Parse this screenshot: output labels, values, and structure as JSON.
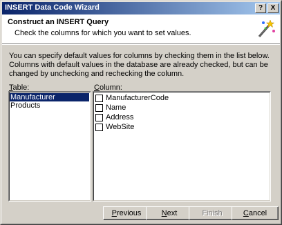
{
  "window": {
    "title": "INSERT Data Code Wizard",
    "help_glyph": "?",
    "close_glyph": "X"
  },
  "header": {
    "title": "Construct an INSERT Query",
    "subtitle": "Check the columns for which you want to set values.",
    "icon": "wizard-wand-icon"
  },
  "description": "You can specify default values for columns by checking them in the list below.  Columns with default values in the database are already checked, but can be changed by unchecking and rechecking the column.",
  "table_label": {
    "hotkey": "T",
    "rest": "able:"
  },
  "column_label": {
    "hotkey": "C",
    "rest": "olumn:"
  },
  "tables": {
    "selected": "Manufacturer",
    "other": "Products"
  },
  "columns": {
    "c0": {
      "name": "ManufacturerCode",
      "checked": false
    },
    "c1": {
      "name": "Name",
      "checked": false
    },
    "c2": {
      "name": "Address",
      "checked": false
    },
    "c3": {
      "name": "WebSite",
      "checked": false
    }
  },
  "buttons": {
    "previous": {
      "hotkey": "P",
      "rest": "revious",
      "enabled": true
    },
    "next": {
      "hotkey": "N",
      "rest": "ext",
      "enabled": true
    },
    "finish": {
      "label": "Finish",
      "enabled": false
    },
    "cancel": {
      "hotkey": "C",
      "rest": "ancel",
      "enabled": true
    }
  },
  "colors": {
    "titlebar_start": "#0a246a",
    "titlebar_end": "#a6caf0",
    "selection": "#0a246a",
    "face": "#d4d0c8"
  }
}
